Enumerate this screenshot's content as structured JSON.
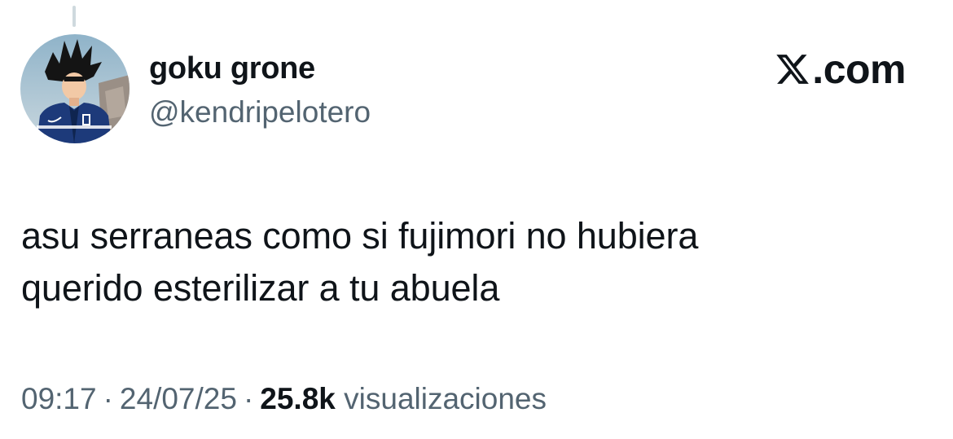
{
  "author": {
    "display_name": "goku grone",
    "handle": "@kendripelotero",
    "avatar": "avatar"
  },
  "brand": {
    "icon": "x-logo-icon",
    "text": ".com"
  },
  "tweet": {
    "text_lines": [
      "asu serraneas como si fujimori no hubiera",
      "querido esterilizar a tu abuela"
    ]
  },
  "meta": {
    "time": "09:17",
    "separator": "·",
    "date": "24/07/25",
    "views_count": "25.8k",
    "views_label": "visualizaciones"
  },
  "colors": {
    "text_primary": "#0f1419",
    "text_secondary": "#536471",
    "thread_line": "#cfd9de"
  }
}
